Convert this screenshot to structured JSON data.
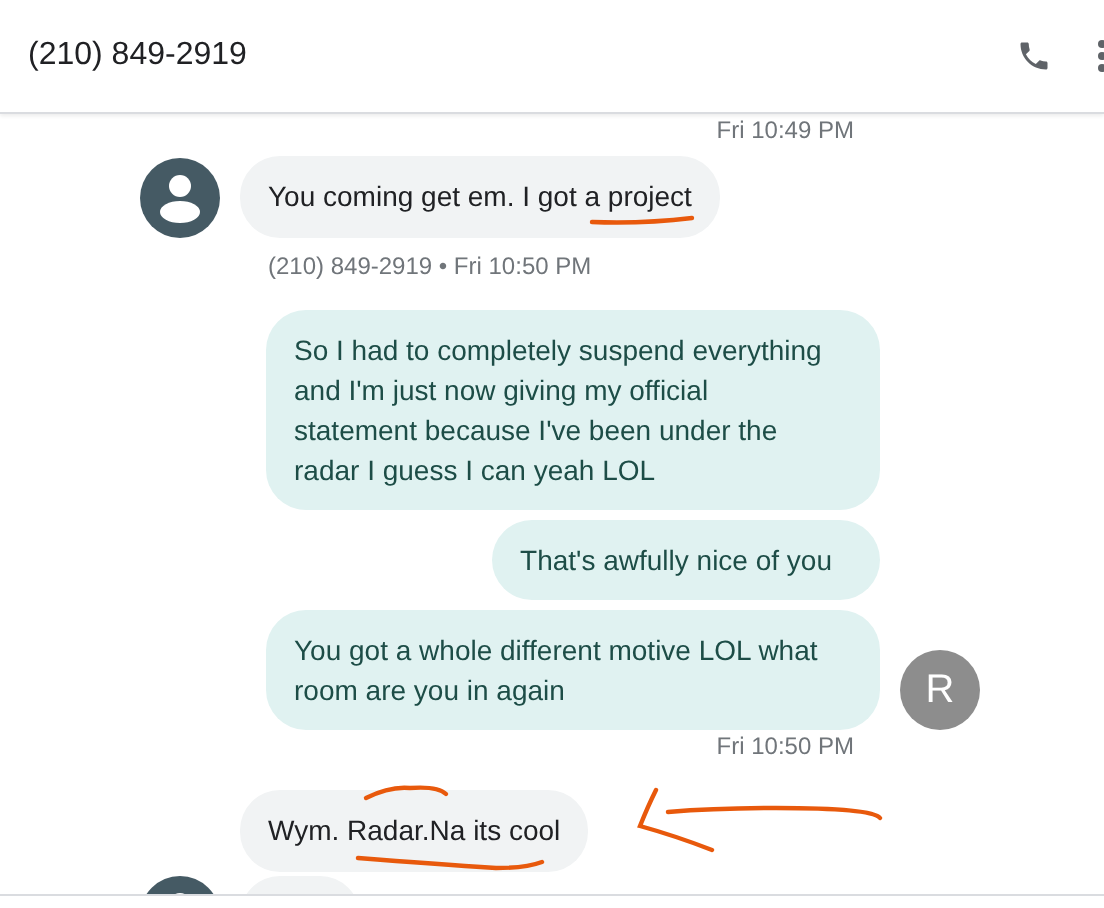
{
  "header": {
    "title": "(210) 849-2919"
  },
  "messages": [
    {
      "kind": "timestamp",
      "text": "Fri 10:49 PM"
    },
    {
      "kind": "incoming",
      "text": "You coming get em. I got a project",
      "avatar": true,
      "underlined": true,
      "arrow": false
    },
    {
      "kind": "meta",
      "text": "(210) 849-2919 • Fri 10:50 PM"
    },
    {
      "kind": "outgoing",
      "text": "So I had to completely suspend everything and I'm just now giving my official statement because I've been under the radar I guess I can yeah LOL"
    },
    {
      "kind": "outgoing",
      "text": "That's awfully nice of you"
    },
    {
      "kind": "outgoing",
      "text": "You got a whole different motive LOL what room are you in again",
      "avatar": "R"
    },
    {
      "kind": "timestamp",
      "text": "Fri 10:50 PM"
    },
    {
      "kind": "incoming",
      "text": "Wym. Radar.Na its cool",
      "avatar": false,
      "underlined": true,
      "arrow": true
    },
    {
      "kind": "incoming",
      "avatar": true,
      "underlined": false,
      "arrow": false
    }
  ]
}
